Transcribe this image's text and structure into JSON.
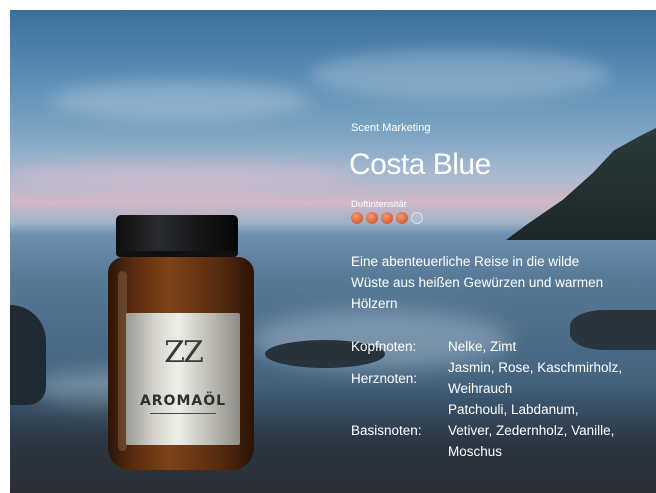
{
  "header": {
    "kicker": "Scent Marketing",
    "product_name": "Costa Blue"
  },
  "intensity": {
    "label": "Duftintensität",
    "value": 4,
    "max": 5,
    "color_on": "#d85f3b"
  },
  "description": [
    "Eine abenteuerliche Reise in die wilde",
    "Wüste aus heißen Gewürzen und warmen",
    "Hölzern"
  ],
  "notes": [
    {
      "label": "Kopfnoten:",
      "value": [
        "Nelke, Zimt"
      ]
    },
    {
      "label": "Herznoten:",
      "value": [
        "Jasmin, Rose, Kaschmirholz,",
        "Weihrauch"
      ]
    },
    {
      "label": "Basisnoten:",
      "value": [
        "Patchouli, Labdanum,",
        "Vetiver, Zedernholz, Vanille,",
        "Moschus"
      ]
    }
  ],
  "jar_label": {
    "monogram": "ZZ",
    "brand": "AROMAÖL"
  }
}
